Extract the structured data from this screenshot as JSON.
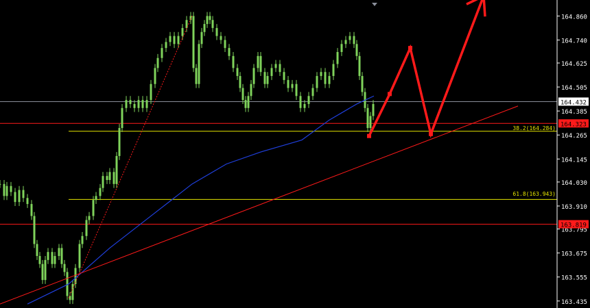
{
  "window": {
    "title": ""
  },
  "colors": {
    "background": "#000000",
    "candle": "#7fd35b",
    "moving_average": "#1f3fdc",
    "trendline": "#ff1a1a",
    "fib_line": "#e6e600",
    "horizontal_red": "#ff1a1a",
    "price_line": "#8a8f9a",
    "axis_text": "#ffffff",
    "projection_arrow": "#ff1a1a"
  },
  "price_axis": {
    "ticks": [
      "164.860",
      "164.740",
      "164.625",
      "164.505",
      "164.385",
      "164.265",
      "164.145",
      "164.030",
      "163.910",
      "163.795",
      "163.675",
      "163.555",
      "163.435"
    ],
    "current_price": "164.432",
    "red_level_label": "164.323",
    "red_level_low_label": "163.819"
  },
  "fibonacci": {
    "levels": [
      {
        "label": "38.2(164.284)",
        "value": 164.284
      },
      {
        "label": "61.8(163.943)",
        "value": 163.943
      }
    ]
  },
  "chart_data": {
    "type": "candlestick",
    "symbol": "",
    "ylim": [
      163.4,
      164.94
    ],
    "series": [
      {
        "kind": "price",
        "points": [
          [
            0,
            164.02
          ],
          [
            6,
            163.96
          ],
          [
            10,
            164.01
          ],
          [
            16,
            163.98
          ],
          [
            22,
            163.93
          ],
          [
            28,
            163.99
          ],
          [
            34,
            163.95
          ],
          [
            40,
            163.92
          ],
          [
            46,
            163.86
          ],
          [
            50,
            163.72
          ],
          [
            54,
            163.66
          ],
          [
            58,
            163.62
          ],
          [
            62,
            163.54
          ],
          [
            66,
            163.64
          ],
          [
            70,
            163.68
          ],
          [
            76,
            163.62
          ],
          [
            80,
            163.66
          ],
          [
            86,
            163.7
          ],
          [
            90,
            163.62
          ],
          [
            94,
            163.58
          ],
          [
            98,
            163.46
          ],
          [
            102,
            163.44
          ],
          [
            106,
            163.52
          ],
          [
            110,
            163.6
          ],
          [
            116,
            163.72
          ],
          [
            120,
            163.76
          ],
          [
            126,
            163.84
          ],
          [
            130,
            163.86
          ],
          [
            136,
            163.94
          ],
          [
            140,
            163.96
          ],
          [
            146,
            164.0
          ],
          [
            150,
            164.06
          ],
          [
            156,
            164.04
          ],
          [
            160,
            164.08
          ],
          [
            166,
            164.02
          ],
          [
            170,
            164.16
          ],
          [
            174,
            164.3
          ],
          [
            178,
            164.4
          ],
          [
            184,
            164.44
          ],
          [
            190,
            164.42
          ],
          [
            196,
            164.4
          ],
          [
            202,
            164.44
          ],
          [
            208,
            164.4
          ],
          [
            214,
            164.44
          ],
          [
            220,
            164.52
          ],
          [
            226,
            164.6
          ],
          [
            230,
            164.65
          ],
          [
            236,
            164.7
          ],
          [
            242,
            164.73
          ],
          [
            248,
            164.76
          ],
          [
            254,
            164.72
          ],
          [
            260,
            164.76
          ],
          [
            266,
            164.8
          ],
          [
            272,
            164.84
          ],
          [
            278,
            164.86
          ],
          [
            282,
            164.6
          ],
          [
            286,
            164.52
          ],
          [
            290,
            164.72
          ],
          [
            294,
            164.78
          ],
          [
            298,
            164.82
          ],
          [
            302,
            164.86
          ],
          [
            306,
            164.84
          ],
          [
            310,
            164.8
          ],
          [
            316,
            164.76
          ],
          [
            322,
            164.74
          ],
          [
            328,
            164.7
          ],
          [
            334,
            164.66
          ],
          [
            340,
            164.6
          ],
          [
            346,
            164.56
          ],
          [
            350,
            164.5
          ],
          [
            354,
            164.44
          ],
          [
            358,
            164.4
          ],
          [
            362,
            164.46
          ],
          [
            366,
            164.52
          ],
          [
            370,
            164.6
          ],
          [
            376,
            164.66
          ],
          [
            380,
            164.58
          ],
          [
            386,
            164.52
          ],
          [
            390,
            164.56
          ],
          [
            396,
            164.6
          ],
          [
            402,
            164.62
          ],
          [
            408,
            164.58
          ],
          [
            414,
            164.54
          ],
          [
            420,
            164.5
          ],
          [
            426,
            164.52
          ],
          [
            432,
            164.46
          ],
          [
            438,
            164.4
          ],
          [
            444,
            164.42
          ],
          [
            450,
            164.46
          ],
          [
            456,
            164.5
          ],
          [
            462,
            164.56
          ],
          [
            468,
            164.58
          ],
          [
            474,
            164.52
          ],
          [
            480,
            164.56
          ],
          [
            486,
            164.62
          ],
          [
            492,
            164.68
          ],
          [
            498,
            164.72
          ],
          [
            504,
            164.74
          ],
          [
            510,
            164.76
          ],
          [
            516,
            164.72
          ],
          [
            520,
            164.66
          ],
          [
            524,
            164.56
          ],
          [
            528,
            164.48
          ],
          [
            532,
            164.4
          ],
          [
            536,
            164.3
          ],
          [
            540,
            164.36
          ],
          [
            544,
            164.42
          ]
        ]
      },
      {
        "kind": "moving_average",
        "points": [
          [
            40,
            163.42
          ],
          [
            100,
            163.52
          ],
          [
            160,
            163.7
          ],
          [
            220,
            163.86
          ],
          [
            280,
            164.02
          ],
          [
            330,
            164.12
          ],
          [
            380,
            164.18
          ],
          [
            440,
            164.24
          ],
          [
            480,
            164.34
          ],
          [
            520,
            164.42
          ],
          [
            545,
            164.46
          ]
        ]
      },
      {
        "kind": "trendline",
        "points": [
          [
            0,
            163.42
          ],
          [
            755,
            164.41
          ]
        ]
      },
      {
        "kind": "dotted_trendline",
        "points": [
          [
            100,
            163.45
          ],
          [
            280,
            164.86
          ]
        ]
      }
    ],
    "projection": {
      "points": [
        [
          538,
          164.26
        ],
        [
          568,
          164.47
        ],
        [
          598,
          164.7
        ],
        [
          628,
          164.27
        ],
        [
          705,
          164.96
        ]
      ]
    },
    "horizontal_lines": [
      {
        "value": 164.432,
        "role": "current_price"
      },
      {
        "value": 164.323,
        "role": "resistance"
      },
      {
        "value": 163.819,
        "role": "support"
      }
    ]
  }
}
